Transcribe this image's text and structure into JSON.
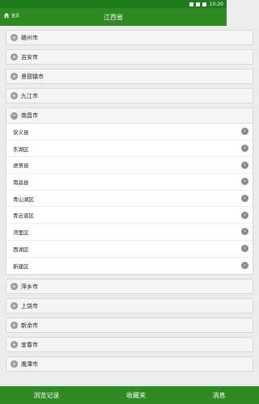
{
  "status_bar": {
    "time": "10:20"
  },
  "header": {
    "home_label": "首页",
    "title": "江西省"
  },
  "cities_before": [
    "赣州市",
    "吉安市",
    "景德镇市",
    "九江市"
  ],
  "expanded_city": {
    "name": "南昌市",
    "counties": [
      "安义县",
      "东湖区",
      "进贤县",
      "南昌县",
      "青山湖区",
      "青云谱区",
      "湾里区",
      "西湖区",
      "新建区"
    ]
  },
  "cities_after": [
    "萍乡市",
    "上饶市",
    "新余市",
    "宜春市",
    "鹰潭市"
  ],
  "bottom_nav": {
    "history": "浏览记录",
    "favorites": "收藏夹",
    "messages": "消息"
  }
}
